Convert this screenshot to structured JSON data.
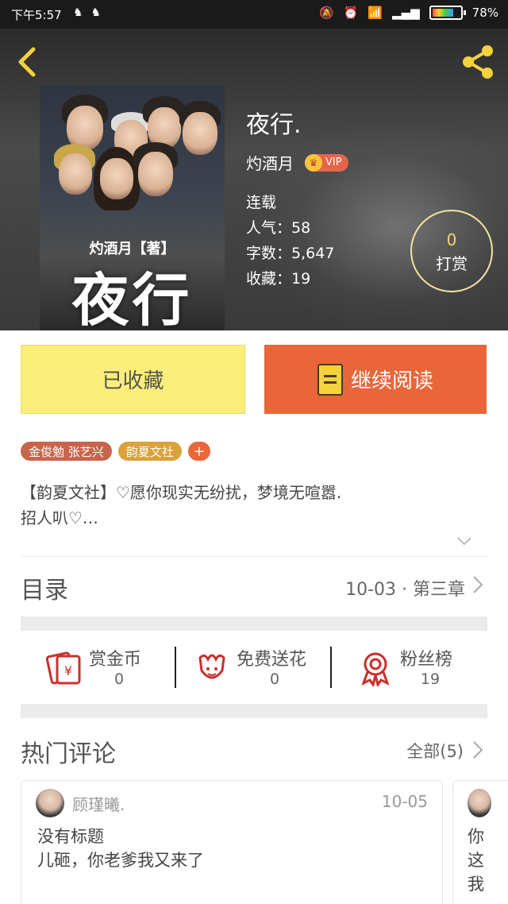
{
  "status_bar": {
    "time": "下午5:57",
    "battery": "78%"
  },
  "book": {
    "title": "夜行.",
    "author": "灼酒月",
    "vip_label": "VIP",
    "status": "连载",
    "popularity": "人气：58",
    "word_count": "字数：5,647",
    "favorites": "收藏：19",
    "cover": {
      "author_line": "灼酒月【著】",
      "title": "夜行"
    }
  },
  "tip": {
    "count": "0",
    "label": "打赏"
  },
  "buttons": {
    "collected": "已收藏",
    "continue_reading": "继续阅读"
  },
  "tags": [
    "金俊勉 张艺兴",
    "韵夏文社",
    "+"
  ],
  "description": "【韵夏文社】♡愿你现实无纷扰，梦境无喧嚣.\n招人叭♡…",
  "catalog": {
    "label": "目录",
    "latest": "10-03 · 第三章"
  },
  "actions": [
    {
      "name": "赏金币",
      "count": "0",
      "icon": "red-envelope-icon"
    },
    {
      "name": "免费送花",
      "count": "0",
      "icon": "flower-icon"
    },
    {
      "name": "粉丝榜",
      "count": "19",
      "icon": "award-ribbon-icon"
    }
  ],
  "comments": {
    "heading": "热门评论",
    "all_label": "全部(5)",
    "items": [
      {
        "user": "顾瑾曦.",
        "date": "10-05",
        "title": "没有标题",
        "body": "儿砸，你老爹我又来了"
      },
      {
        "lines": [
          "你",
          "这",
          "我"
        ]
      }
    ]
  },
  "colors": {
    "accent_orange": "#e8663a",
    "collected_yellow": "#fbee7a",
    "back_yellow": "#f3d23a"
  }
}
